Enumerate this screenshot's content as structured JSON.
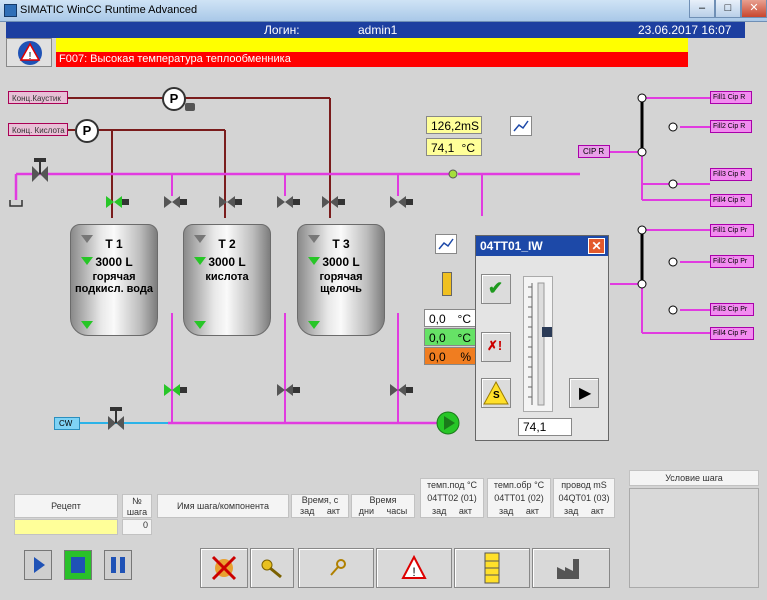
{
  "window": {
    "title": "SIMATIC WinCC Runtime Advanced",
    "btn_min": "–",
    "btn_max": "□",
    "btn_close": "✕"
  },
  "header": {
    "login_label": "Логин:",
    "user": "admin1",
    "datetime": "23.06.2017 16:07"
  },
  "alarm": {
    "message": "F007: Высокая температура теплообменника"
  },
  "process": {
    "tag_caustic": "Конц.Каустик",
    "tag_acid": "Конц. Кислота",
    "pump_symbol": "P",
    "cond_value": "126,2mS",
    "temp_value": "74,1",
    "temp_unit": "°C",
    "cip_r": "CIP R",
    "cw_tag": "CW",
    "fill_outputs": [
      "Fill1 Cip R",
      "Fill2 Cip R",
      "Fill3 Cip R",
      "Fill4 Cip R"
    ],
    "fill_inputs": [
      "Fill1 Cip Pr",
      "Fill2 Cip Pr",
      "Fill3 Cip Pr",
      "Fill4 Cip Pr"
    ],
    "readouts": [
      {
        "value": "0,0",
        "unit": "°C",
        "color": "#ffffff"
      },
      {
        "value": "0,0",
        "unit": "°C",
        "color": "#66e266"
      },
      {
        "value": "0,0",
        "unit": "%",
        "color": "#f07d20"
      }
    ]
  },
  "tanks": [
    {
      "name": "T 1",
      "volume": "3000 L",
      "desc_line1": "горячая",
      "desc_line2": "подкисл. вода"
    },
    {
      "name": "T 2",
      "volume": "3000 L",
      "desc_line1": "кислота",
      "desc_line2": ""
    },
    {
      "name": "T 3",
      "volume": "3000 L",
      "desc_line1": "горячая",
      "desc_line2": "щелочь"
    }
  ],
  "dialog": {
    "title": "04TT01_IW",
    "value": "74,1",
    "btn_ok": "✔",
    "btn_cancel": "✗!",
    "btn_s": "S",
    "btn_next": "▶"
  },
  "table": {
    "recipe": "Рецепт",
    "step_no": "№\nшага",
    "step_no_l1": "№",
    "step_no_l2": "шага",
    "step_name": "Имя шага/компонента",
    "time_s": "Время, с",
    "time_s_set": "зад",
    "time_s_act": "акт",
    "time_days": "Время",
    "time_days_d": "дни",
    "time_days_h": "часы",
    "temp_supply": "темп.под °C",
    "temp_supply_tag": "04TT02 (01)",
    "temp_return": "темп.обр °C",
    "temp_return_tag": "04TT01 (02)",
    "conductivity": "провод mS",
    "conductivity_tag": "04QT01 (03)",
    "set": "зад",
    "act": "акт",
    "step_value": "0",
    "step_condition": "Условие шага"
  }
}
